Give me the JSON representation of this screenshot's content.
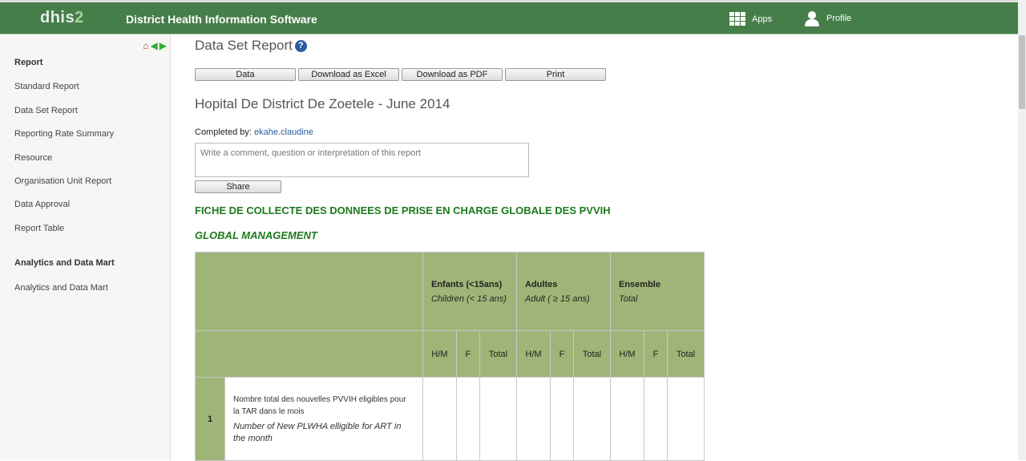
{
  "header": {
    "logo": "dhis2",
    "title": "District Health Information Software",
    "apps": "Apps",
    "profile": "Profile"
  },
  "sidebar": {
    "sections": [
      {
        "title": "Report",
        "items": [
          "Standard Report",
          "Data Set Report",
          "Reporting Rate Summary",
          "Resource",
          "Organisation Unit Report",
          "Data Approval",
          "Report Table"
        ]
      },
      {
        "title": "Analytics and Data Mart",
        "items": [
          "Analytics and Data Mart"
        ]
      }
    ]
  },
  "page": {
    "title": "Data Set Report",
    "help": "?",
    "buttons": [
      "Data",
      "Download as Excel",
      "Download as PDF",
      "Print"
    ],
    "report_title": "Hopital De District De Zoetele - June 2014",
    "completed_label": "Completed by:",
    "completed_by": "ekahe.claudine",
    "comment_placeholder": "Write a comment, question or interpretation of this report",
    "share": "Share",
    "form_title": "FICHE DE COLLECTE DES DONNEES DE PRISE EN CHARGE GLOBALE DES PVVIH",
    "section_title": "GLOBAL MANAGEMENT"
  },
  "table": {
    "groups": [
      {
        "fr": "Enfants (<15ans)",
        "en": "Children (< 15 ans)"
      },
      {
        "fr": "Adultes",
        "en": "Adult ( ≥ 15 ans)"
      },
      {
        "fr": "Ensemble",
        "en": "Total"
      }
    ],
    "subcols": [
      "H/M",
      "F",
      "Total"
    ],
    "rows": [
      {
        "num": "1",
        "fr": "Nombre total des nouvelles PVVIH eligibles pour la TAR dans le mois",
        "en": "Number of New PLWHA elligible for ART in the month",
        "values": [
          "",
          "",
          "",
          "",
          "",
          "",
          "",
          "",
          ""
        ]
      }
    ]
  }
}
